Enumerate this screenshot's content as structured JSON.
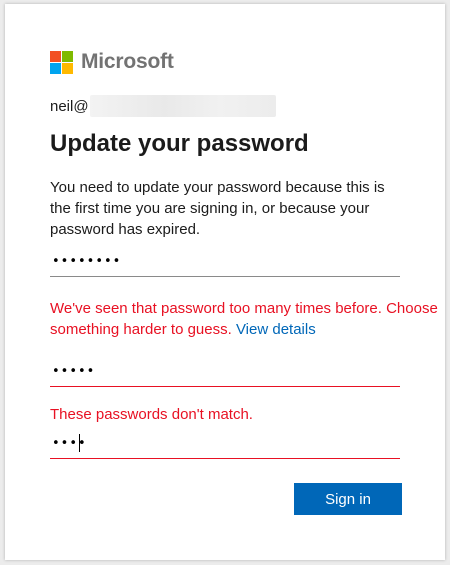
{
  "brand": {
    "name": "Microsoft",
    "logo_colors": [
      "#f25022",
      "#7fba00",
      "#00a4ef",
      "#ffb900"
    ]
  },
  "identity": {
    "email_prefix": "neil@"
  },
  "page": {
    "title": "Update your password",
    "description": "You need to update your password because this is the first time you are signing in, or because your password has expired."
  },
  "form": {
    "current_password": {
      "value": "••••••••"
    },
    "new_password": {
      "value": "•••••",
      "error": "We've seen that password too many times before. Choose something harder to guess.",
      "error_link": "View details"
    },
    "confirm_password": {
      "value": "••••",
      "error": "These passwords don't match."
    },
    "submit_label": "Sign in"
  },
  "colors": {
    "accent": "#0067b8",
    "error": "#e81123"
  }
}
